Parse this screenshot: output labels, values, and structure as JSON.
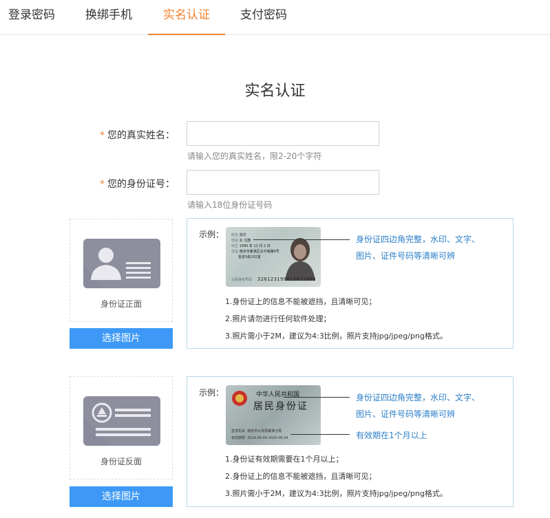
{
  "tabs": [
    {
      "label": "登录密码"
    },
    {
      "label": "换绑手机"
    },
    {
      "label": "实名认证"
    },
    {
      "label": "支付密码"
    }
  ],
  "title": "实名认证",
  "form": {
    "required_mark": "*",
    "name": {
      "label": "您的真实姓名：",
      "value": "",
      "hint": "请输入您的真实姓名，限2-20个字符"
    },
    "id_number": {
      "label": "您的身份证号：",
      "value": "",
      "hint": "请输入18位身份证号码"
    }
  },
  "front": {
    "caption": "身份证正面",
    "button": "选择图片",
    "example_label": "示例：",
    "card_text": {
      "name_key": "姓名",
      "name_val": "张华",
      "sex_key": "性别",
      "sex_val": "女",
      "nation_val": "汉族",
      "birth_key": "出生",
      "birth_val": "1990 年 12 月 2 日",
      "addr_key": "住址",
      "addr_val": "南京市秦淮区太平南路6号",
      "addr_val2": "嘉泉5栋202室",
      "id_key": "公民身份号码",
      "id_val": "320123199012021860"
    },
    "note_lines": [
      "身份证四边角完整，水印、文字、",
      "图片、证件号码等清晰可辨"
    ],
    "rules": [
      "1.身份证上的信息不能被遮挡，且清晰可见；",
      "2.照片请勿进行任何软件处理；",
      "3.照片需小于2M，建议为4:3比例，照片支持jpg/jpeg/png格式。"
    ]
  },
  "back": {
    "caption": "身份证反面",
    "button": "选择图片",
    "example_label": "示例：",
    "card_text": {
      "country": "中华人民共和国",
      "title": "居民身份证",
      "issuer_key": "签发机关",
      "issuer_val": "南京市公安局秦淮分局",
      "valid_key": "有效期限",
      "valid_val": "2014.06.04-2024.06.04"
    },
    "note_lines": [
      "身份证四边角完整，水印、文字、",
      "图片、证件号码等清晰可辨"
    ],
    "validity_note": "有效期在1个月以上",
    "rules": [
      "1.身份证有效期需要在1个月以上；",
      "2.身份证上的信息不能被遮挡，且清晰可见；",
      "3.照片需小于2M，建议为4:3比例，照片支持jpg/jpeg/png格式。"
    ]
  },
  "colors": {
    "accent": "#f08232",
    "button": "#3d99f5",
    "note": "#2b7fc8",
    "icon": "#8e8f9d"
  }
}
